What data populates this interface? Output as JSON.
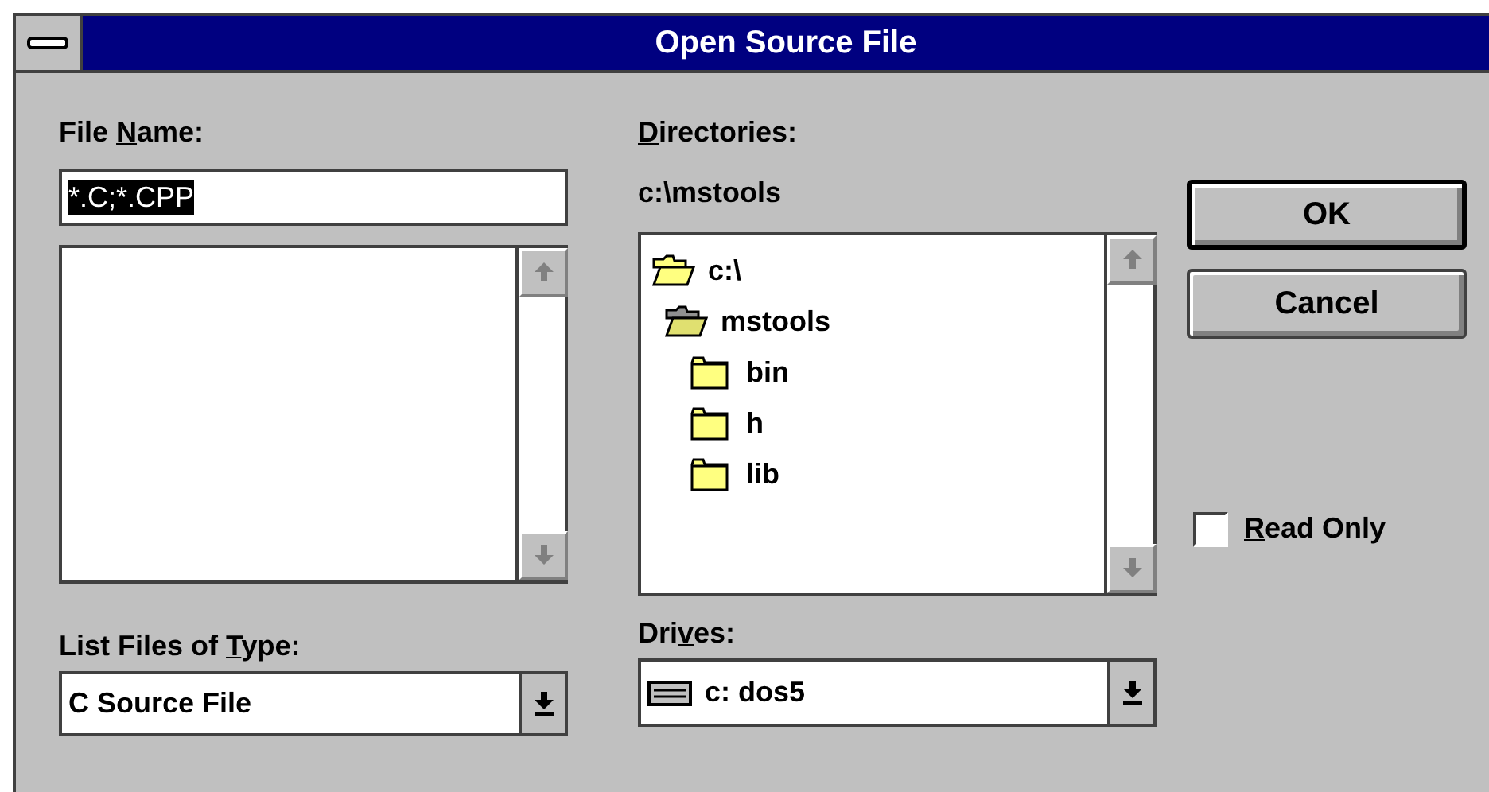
{
  "window": {
    "title": "Open Source File"
  },
  "file_name": {
    "label": {
      "before": "File ",
      "key": "N",
      "after": "ame:"
    },
    "value": "*.C;*.CPP",
    "selected": true
  },
  "directories": {
    "label": {
      "key": "D",
      "after": "irectories:"
    },
    "path": "c:\\mstools",
    "tree": [
      {
        "name": "c:\\",
        "kind": "open",
        "children": [
          {
            "name": "mstools",
            "kind": "current",
            "children": [
              {
                "name": "bin",
                "kind": "closed"
              },
              {
                "name": "h",
                "kind": "closed"
              },
              {
                "name": "lib",
                "kind": "closed"
              }
            ]
          }
        ]
      }
    ]
  },
  "file_type": {
    "label": {
      "before": "List Files of ",
      "key": "T",
      "after": "ype:"
    },
    "value": "C Source File"
  },
  "drives": {
    "label": {
      "before": "Dri",
      "key": "v",
      "after": "es:"
    },
    "value": "c: dos5"
  },
  "buttons": [
    {
      "label": "OK",
      "default": true
    },
    {
      "label": "Cancel",
      "default": false
    }
  ],
  "read_only": {
    "label": {
      "key": "R",
      "after": "ead Only"
    },
    "checked": false
  }
}
